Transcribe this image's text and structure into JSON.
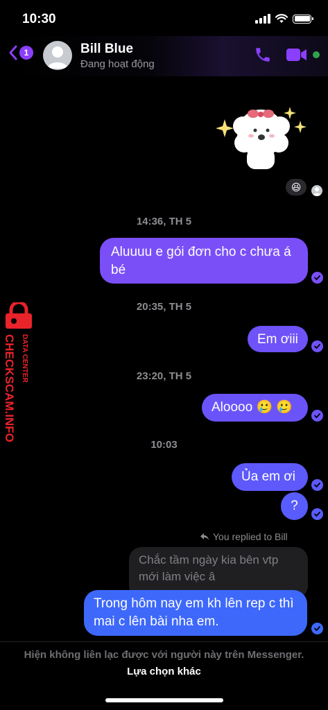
{
  "status_bar": {
    "time": "10:30"
  },
  "header": {
    "back_badge": "1",
    "name": "Bill Blue",
    "status": "Đang hoạt động"
  },
  "sticker": {
    "reaction_emoji": "😆"
  },
  "messages": [
    {
      "timestamp": "14:36, TH 5",
      "text": "Aluuuu e gói đơn cho c chưa á bé"
    },
    {
      "timestamp": "20:35, TH 5",
      "text": "Em ơiii"
    },
    {
      "timestamp": "23:20, TH 5",
      "text": "Aloooo 🥲 🥲"
    },
    {
      "timestamp": "10:03",
      "text": "Ủa em ơi"
    },
    {
      "text": "?"
    },
    {
      "reply_label": "You replied to Bill",
      "quoted_text": "Chắc tầm ngày kia bên vtp mới làm việc â",
      "text": "Trong hôm nay em kh lên rep c thì mai c lên bài nha em."
    }
  ],
  "footer": {
    "notice": "Hiện không liên lạc được với người này trên Messenger.",
    "link": "Lựa chọn khác"
  },
  "watermark": {
    "main": "CHECKSCAM.INFO",
    "sub": "DATA CENTER"
  },
  "colors": {
    "accent": "#8a3ffc",
    "bubble_top": "#7a4ff7",
    "bubble_bottom": "#3d68fa",
    "online": "#31a24c"
  },
  "icons": [
    "back-chevron-icon",
    "phone-icon",
    "video-camera-icon",
    "reply-arrow-icon",
    "checkmark-icon",
    "padlock-icon"
  ]
}
